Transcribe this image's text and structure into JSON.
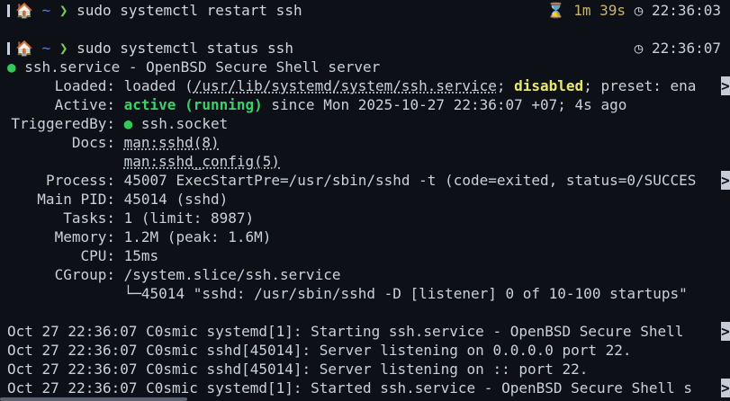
{
  "prompt1": {
    "home_icon": "🏠",
    "tilde": "~",
    "arrow": "❯",
    "command": "sudo systemctl restart ssh",
    "duration": "1m 39s",
    "time": "22:36:03"
  },
  "prompt2": {
    "home_icon": "🏠",
    "tilde": "~",
    "arrow": "❯",
    "command": "sudo systemctl status ssh",
    "time": "22:36:07"
  },
  "status": {
    "dot": "●",
    "title": "ssh.service - OpenBSD Secure Shell server",
    "loaded_label": "Loaded:",
    "loaded_prefix": "loaded (",
    "loaded_path": "/usr/lib/systemd/system/ssh.service",
    "loaded_sep": "; ",
    "loaded_disabled": "disabled",
    "loaded_rest": "; preset: ena",
    "active_label": "Active:",
    "active_state": "active (running)",
    "active_rest": " since Mon 2025-10-27 22:36:07 +07; 4s ago",
    "triggered_label": "TriggeredBy:",
    "triggered_dot": "●",
    "triggered_value": "ssh.socket",
    "docs_label": "Docs:",
    "docs_1": "man:sshd(8)",
    "docs_2": "man:sshd_config(5)",
    "process_label": "Process:",
    "process_value": "45007 ExecStartPre=/usr/sbin/sshd -t (code=exited, status=0/SUCCES",
    "mainpid_label": "Main PID:",
    "mainpid_value": "45014 (sshd)",
    "tasks_label": "Tasks:",
    "tasks_value": "1 (limit: 8987)",
    "memory_label": "Memory:",
    "memory_value": "1.2M (peak: 1.6M)",
    "cpu_label": "CPU:",
    "cpu_value": "15ms",
    "cgroup_label": "CGroup:",
    "cgroup_value": "/system.slice/ssh.service",
    "cgroup_child": "└─45014 \"sshd: /usr/sbin/sshd -D [listener] 0 of 10-100 startups\""
  },
  "logs": [
    "Oct 27 22:36:07 C0smic systemd[1]: Starting ssh.service - OpenBSD Secure Shell ",
    "Oct 27 22:36:07 C0smic sshd[45014]: Server listening on 0.0.0.0 port 22.",
    "Oct 27 22:36:07 C0smic sshd[45014]: Server listening on :: port 22.",
    "Oct 27 22:36:07 C0smic systemd[1]: Started ssh.service - OpenBSD Secure Shell s"
  ],
  "truncation_marker": ">",
  "icons": {
    "hourglass": "⌛",
    "clock": "◷"
  }
}
